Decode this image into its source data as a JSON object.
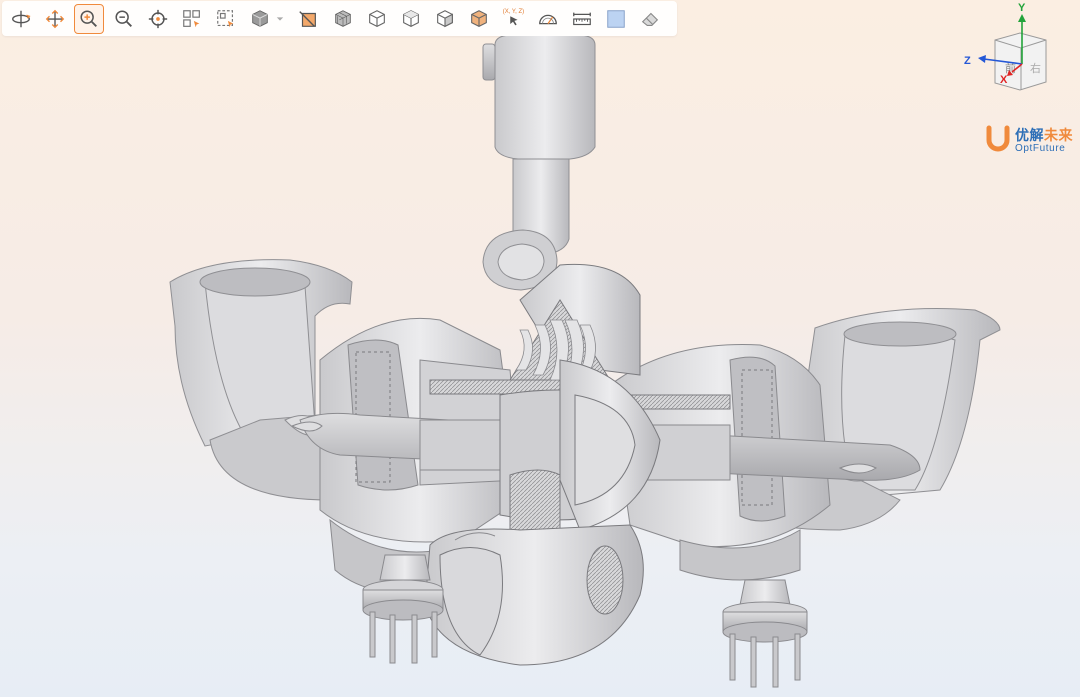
{
  "toolbar": {
    "tools": [
      {
        "name": "rotate-tool",
        "icon": "rotate-icon"
      },
      {
        "name": "pan-tool",
        "icon": "pan-icon"
      },
      {
        "name": "zoom-in-tool",
        "icon": "zoom-in-icon",
        "active": true
      },
      {
        "name": "zoom-out-tool",
        "icon": "zoom-out-icon"
      },
      {
        "name": "fit-center-tool",
        "icon": "target-icon"
      },
      {
        "name": "box-select-tool",
        "icon": "box-select-icon"
      },
      {
        "name": "window-select-tool",
        "icon": "window-select-icon"
      },
      {
        "name": "view-cube-tool",
        "icon": "cube-dropdown-icon"
      },
      {
        "name": "section-plane-tool",
        "icon": "section-plane-icon"
      },
      {
        "name": "wireframe-tool",
        "icon": "wireframe-cube-icon"
      },
      {
        "name": "view-front-tool",
        "icon": "cube-front-icon"
      },
      {
        "name": "view-top-tool",
        "icon": "cube-top-icon"
      },
      {
        "name": "view-side-tool",
        "icon": "cube-side-icon"
      },
      {
        "name": "view-iso-tool",
        "icon": "cube-iso-icon"
      },
      {
        "name": "coordinate-pick-tool",
        "icon": "cursor-icon",
        "label": "(X, Y, Z)"
      },
      {
        "name": "angle-measure-tool",
        "icon": "protractor-icon"
      },
      {
        "name": "distance-measure-tool",
        "icon": "ruler-icon"
      },
      {
        "name": "background-color-tool",
        "icon": "color-swatch-icon"
      },
      {
        "name": "eraser-tool",
        "icon": "eraser-icon"
      }
    ],
    "accent": "#f08a3c"
  },
  "triad": {
    "y_label": "Y",
    "z_label": "Z",
    "x_label": "X",
    "cube_front": "前",
    "cube_right": "右",
    "colors": {
      "x": "#e02424",
      "y": "#22a33a",
      "z": "#2457d6"
    }
  },
  "logo": {
    "cn_part1": "优解",
    "cn_part2": "未来",
    "en": "OptFuture",
    "colors": {
      "blue": "#2e6fb7",
      "orange": "#f08a3c"
    }
  }
}
